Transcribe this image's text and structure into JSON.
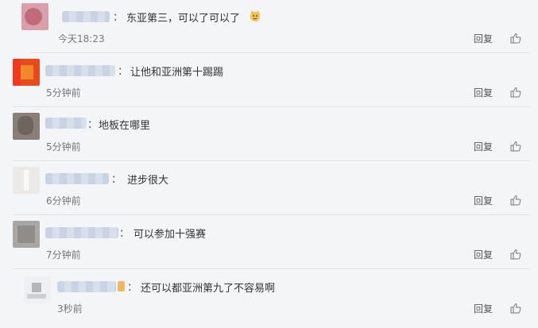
{
  "comments": [
    {
      "text": "东亚第三，可以了可以了",
      "time": "今天18:23",
      "reply_label": "回复"
    },
    {
      "text": "让他和亚洲第十踢踢",
      "time": "5分钟前",
      "reply_label": "回复"
    },
    {
      "text": "地板在哪里",
      "time": "5分钟前",
      "reply_label": "回复"
    },
    {
      "text": "进步很大",
      "time": "6分钟前",
      "reply_label": "回复"
    },
    {
      "text": "可以参加十强赛",
      "time": "7分钟前",
      "reply_label": "回复"
    },
    {
      "text": "还可以都亚洲第九了不容易啊",
      "time": "3秒前",
      "reply_label": "回复"
    }
  ],
  "icons": {
    "like": "thumbs-up-icon",
    "emoji": "cat-face-emoji-icon"
  },
  "colors": {
    "background": "#f4f5f7",
    "username_blur": "#c9d3e3"
  }
}
